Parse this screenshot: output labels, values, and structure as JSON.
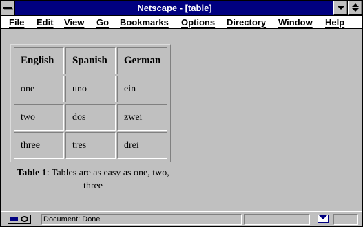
{
  "window": {
    "title": "Netscape - [table]"
  },
  "menubar": {
    "items": [
      "File",
      "Edit",
      "View",
      "Go",
      "Bookmarks",
      "Options",
      "Directory",
      "Window",
      "Help"
    ]
  },
  "table": {
    "headers": [
      "English",
      "Spanish",
      "German"
    ],
    "rows": [
      [
        "one",
        "uno",
        "ein"
      ],
      [
        "two",
        "dos",
        "zwei"
      ],
      [
        "three",
        "tres",
        "drei"
      ]
    ],
    "caption_label": "Table 1",
    "caption_text": ": Tables are as easy as one, two, three"
  },
  "statusbar": {
    "status_text": "Document: Done"
  },
  "colors": {
    "titlebar": "#000080",
    "chrome": "#c0c0c0"
  }
}
